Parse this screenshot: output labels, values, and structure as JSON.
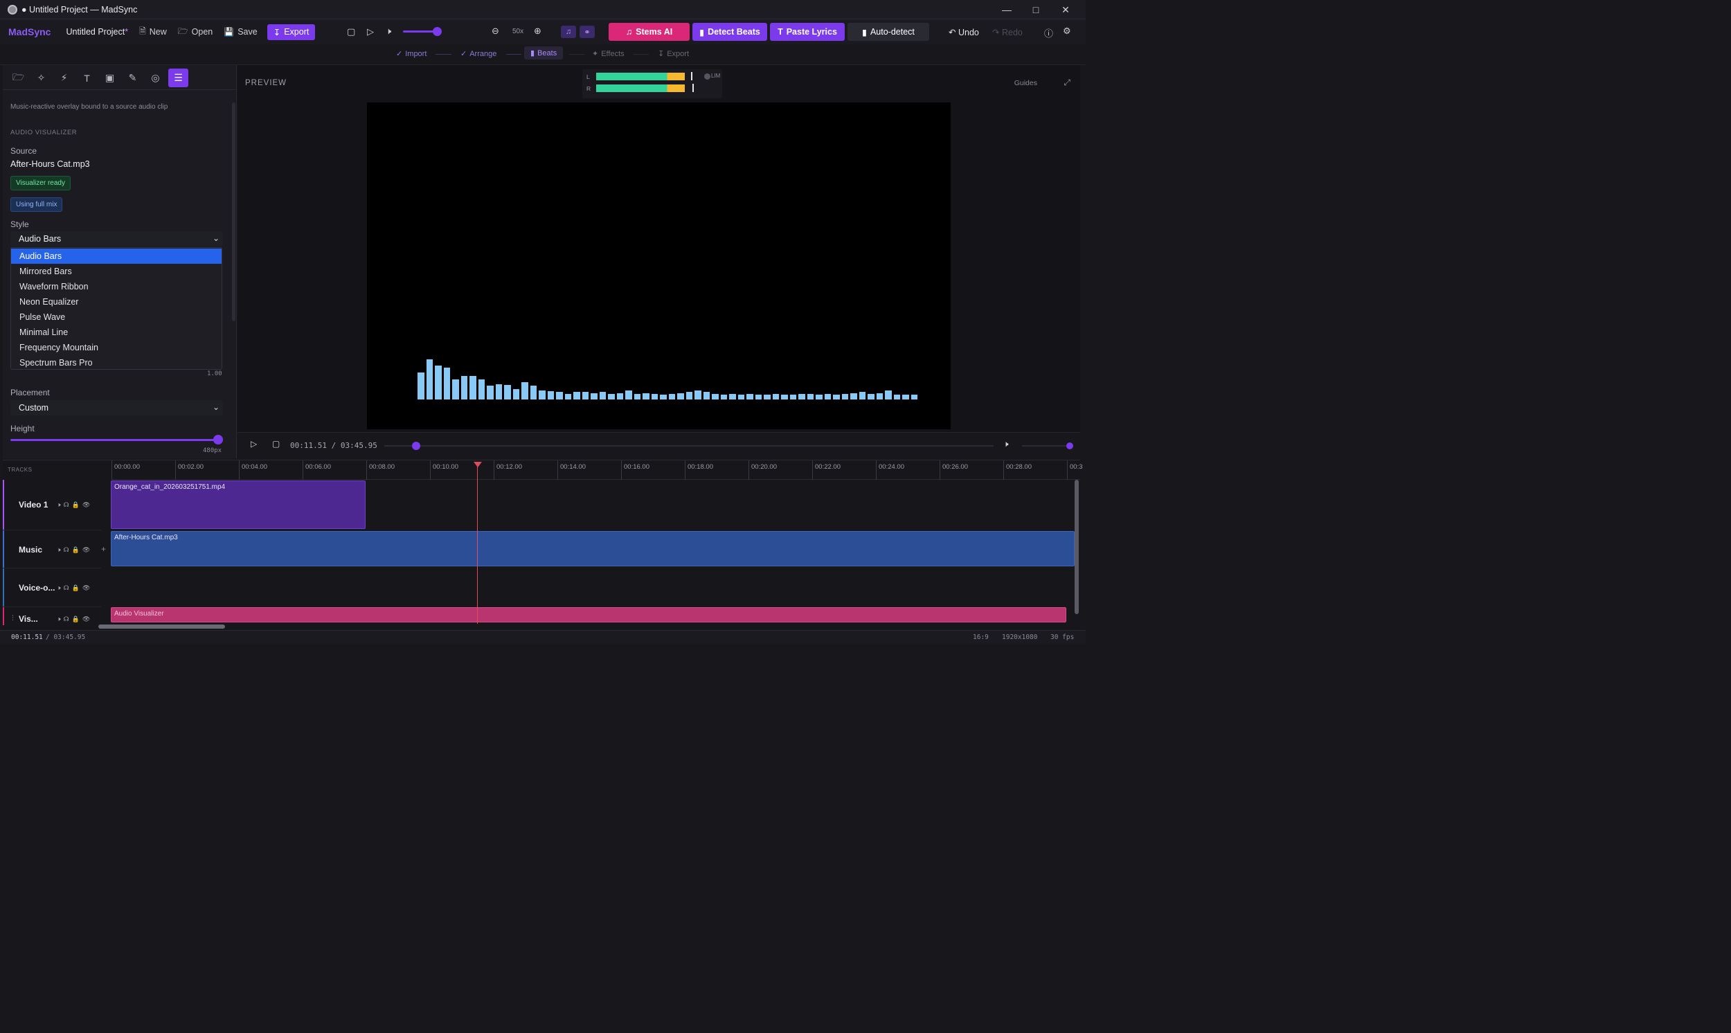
{
  "window": {
    "title": "● Untitled Project — MadSync",
    "controls": [
      "minimize-icon",
      "maximize-icon",
      "close-icon"
    ]
  },
  "toolbar": {
    "brand": "MadSync",
    "project_name": "Untitled Project",
    "unsaved_marker": "*",
    "new_label": "New",
    "open_label": "Open",
    "save_label": "Save",
    "export_label": "Export",
    "zoom_label": "50x",
    "volume_level": 0.9,
    "stems_label": "Stems AI",
    "detect_beats_label": "Detect Beats",
    "paste_lyrics_label": "Paste Lyrics",
    "auto_detect_label": "Auto-detect",
    "undo_label": "Undo",
    "redo_label": "Redo"
  },
  "steps": [
    {
      "label": "Import",
      "state": "done"
    },
    {
      "label": "Arrange",
      "state": "done"
    },
    {
      "label": "Beats",
      "state": "active"
    },
    {
      "label": "Effects",
      "state": "pending"
    },
    {
      "label": "Export",
      "state": "pending"
    }
  ],
  "left_panel": {
    "description": "Music-reactive overlay bound to a source audio clip",
    "section_title": "AUDIO VISUALIZER",
    "source_label": "Source",
    "source_value": "After-Hours Cat.mp3",
    "ready_badge": "Visualizer ready",
    "mix_badge": "Using full mix",
    "style_label": "Style",
    "style_value": "Audio Bars",
    "style_options": [
      "Audio Bars",
      "Mirrored Bars",
      "Waveform Ribbon",
      "Neon Equalizer",
      "Pulse Wave",
      "Minimal Line",
      "Frequency Mountain",
      "Spectrum Bars Pro"
    ],
    "hidden_slider_value": "1.00",
    "placement_label": "Placement",
    "placement_value": "Custom",
    "height_label": "Height",
    "height_value": "480px",
    "height_fraction": 1.0
  },
  "preview": {
    "label": "PREVIEW",
    "guides_label": "Guides",
    "meter_left": "L",
    "meter_right": "R",
    "limiter_label": "LIM",
    "current_time": "00:11.51",
    "separator": "/",
    "total_time": "03:45.95",
    "progress_fraction": 0.052,
    "spectrum_levels": [
      0.55,
      0.83,
      0.7,
      0.65,
      0.42,
      0.48,
      0.48,
      0.42,
      0.28,
      0.32,
      0.3,
      0.22,
      0.35,
      0.28,
      0.18,
      0.17,
      0.15,
      0.12,
      0.15,
      0.15,
      0.13,
      0.15,
      0.12,
      0.13,
      0.18,
      0.12,
      0.13,
      0.12,
      0.1,
      0.12,
      0.13,
      0.15,
      0.18,
      0.15,
      0.12,
      0.1,
      0.12,
      0.1,
      0.12,
      0.1,
      0.1,
      0.12,
      0.1,
      0.1,
      0.12,
      0.12,
      0.1,
      0.12,
      0.1,
      0.12,
      0.13,
      0.15,
      0.12,
      0.13,
      0.18,
      0.1,
      0.1,
      0.1
    ]
  },
  "timeline": {
    "tracks_label": "TRACKS",
    "ruler": [
      "00:00.00",
      "00:02.00",
      "00:04.00",
      "00:06.00",
      "00:08.00",
      "00:10.00",
      "00:12.00",
      "00:14.00",
      "00:16.00",
      "00:18.00",
      "00:20.00",
      "00:22.00",
      "00:24.00",
      "00:26.00",
      "00:28.00",
      "00:3"
    ],
    "tracks": [
      {
        "name": "Video 1",
        "accent": "#a855f7"
      },
      {
        "name": "Music",
        "accent": "#3b6fd4"
      },
      {
        "name": "Voice-o...",
        "accent": "#2f6fb8"
      },
      {
        "name": "Vis...",
        "accent": "#db2777"
      }
    ],
    "clips": {
      "video": "Orange_cat_in_202603251751.mp4",
      "music": "After-Hours Cat.mp3",
      "visualizer": "Audio Visualizer"
    }
  },
  "statusbar": {
    "time": "00:11.51",
    "total": "/ 03:45.95",
    "aspect": "16:9",
    "resolution": "1920x1080",
    "fps": "30 fps"
  }
}
